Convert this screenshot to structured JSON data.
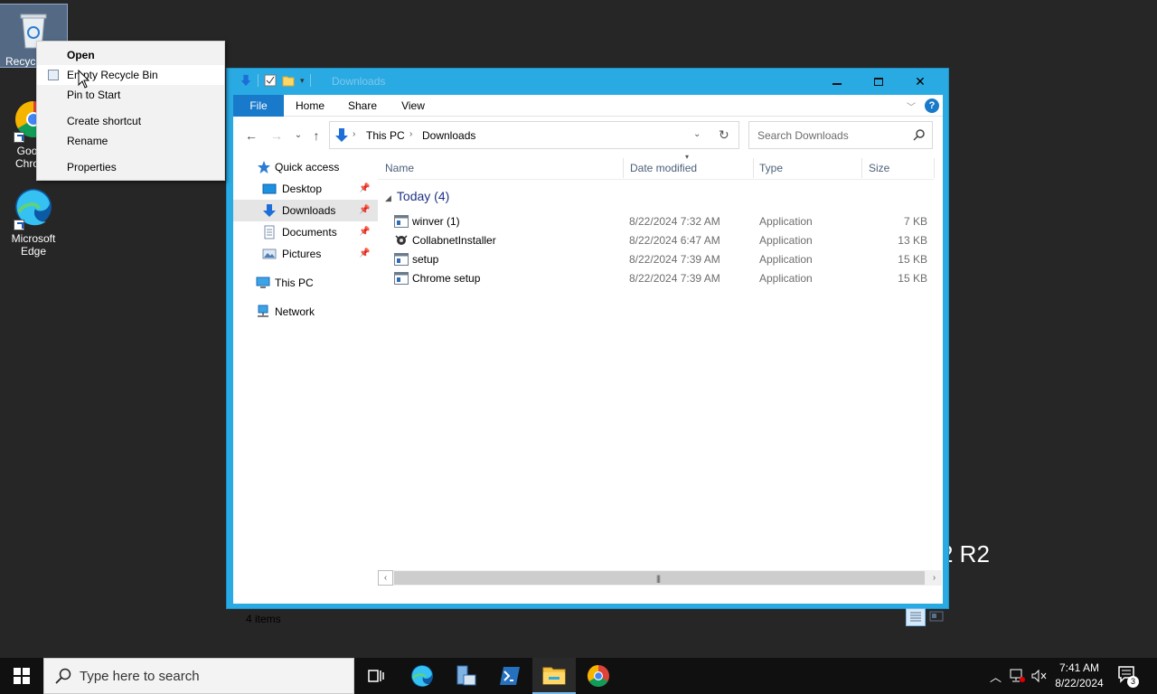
{
  "desktop": {
    "icons": [
      {
        "label": "Recyc"
      },
      {
        "label": "Goo Chro"
      },
      {
        "label": "Microsoft Edge"
      }
    ],
    "background_text": "2 R2"
  },
  "context_menu": {
    "items": [
      {
        "label": "Open",
        "bold": true
      },
      {
        "label": "Empty Recycle Bin"
      },
      {
        "label": "Pin to Start"
      },
      {
        "label": "Create shortcut"
      },
      {
        "label": "Rename"
      },
      {
        "label": "Properties"
      }
    ]
  },
  "explorer": {
    "title": "Downloads",
    "ribbon_tabs": [
      "File",
      "Home",
      "Share",
      "View"
    ],
    "help_label": "?",
    "address": {
      "crumbs": [
        "This PC",
        "Downloads"
      ]
    },
    "search": {
      "placeholder": "Search Downloads"
    },
    "nav": {
      "quick_access": "Quick access",
      "items": [
        "Desktop",
        "Downloads",
        "Documents",
        "Pictures"
      ],
      "this_pc": "This PC",
      "network": "Network"
    },
    "columns": [
      "Name",
      "Date modified",
      "Type",
      "Size"
    ],
    "group_label": "Today (4)",
    "files": [
      {
        "name": "winver (1)",
        "date": "8/22/2024 7:32 AM",
        "type": "Application",
        "size": "7 KB"
      },
      {
        "name": "CollabnetInstaller",
        "date": "8/22/2024 6:47 AM",
        "type": "Application",
        "size": "13 KB"
      },
      {
        "name": "setup",
        "date": "8/22/2024 7:39 AM",
        "type": "Application",
        "size": "15 KB"
      },
      {
        "name": "Chrome setup",
        "date": "8/22/2024 7:39 AM",
        "type": "Application",
        "size": "15 KB"
      }
    ],
    "status": "4 items"
  },
  "taskbar": {
    "search_placeholder": "Type here to search",
    "time": "7:41 AM",
    "date": "8/22/2024",
    "notification_count": "3"
  },
  "colors": {
    "window_border": "#2aaae3",
    "file_tab": "#1979ca",
    "taskbar": "#101010",
    "desktop": "#262626"
  }
}
